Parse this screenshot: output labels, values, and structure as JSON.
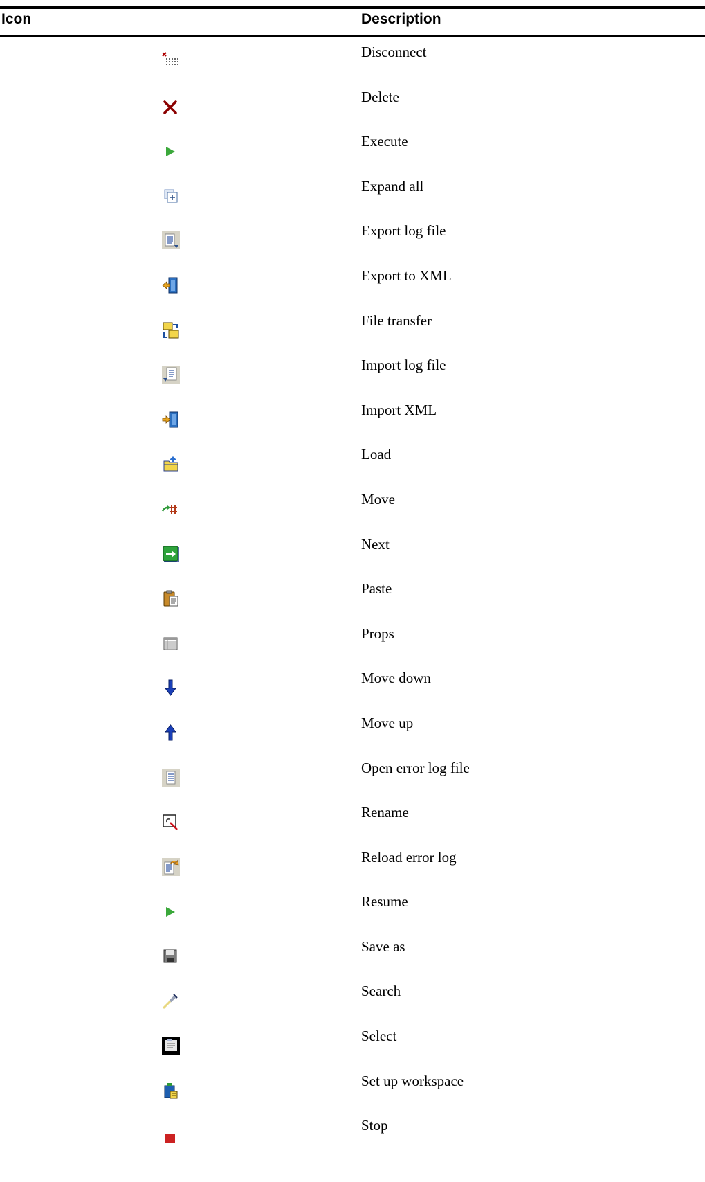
{
  "headers": {
    "icon": "Icon",
    "description": "Description"
  },
  "rows": [
    {
      "icon": "disconnect-icon",
      "label": "Disconnect"
    },
    {
      "icon": "delete-icon",
      "label": "Delete"
    },
    {
      "icon": "execute-icon",
      "label": "Execute"
    },
    {
      "icon": "expand-all-icon",
      "label": "Expand all"
    },
    {
      "icon": "export-log-file-icon",
      "label": "Export log file"
    },
    {
      "icon": "export-to-xml-icon",
      "label": "Export to XML"
    },
    {
      "icon": "file-transfer-icon",
      "label": "File transfer"
    },
    {
      "icon": "import-log-file-icon",
      "label": "Import log file"
    },
    {
      "icon": "import-xml-icon",
      "label": "Import XML"
    },
    {
      "icon": "load-icon",
      "label": "Load"
    },
    {
      "icon": "move-icon",
      "label": "Move"
    },
    {
      "icon": "next-icon",
      "label": "Next"
    },
    {
      "icon": "paste-icon",
      "label": "Paste"
    },
    {
      "icon": "props-icon",
      "label": "Props"
    },
    {
      "icon": "move-down-icon",
      "label": "Move down"
    },
    {
      "icon": "move-up-icon",
      "label": "Move up"
    },
    {
      "icon": "open-error-log-file-icon",
      "label": "Open error log file"
    },
    {
      "icon": "rename-icon",
      "label": "Rename"
    },
    {
      "icon": "reload-error-log-icon",
      "label": "Reload error log"
    },
    {
      "icon": "resume-icon",
      "label": "Resume"
    },
    {
      "icon": "save-as-icon",
      "label": "Save as"
    },
    {
      "icon": "search-icon",
      "label": "Search"
    },
    {
      "icon": "select-icon",
      "label": "Select"
    },
    {
      "icon": "set-up-workspace-icon",
      "label": "Set up workspace"
    },
    {
      "icon": "stop-icon",
      "label": "Stop"
    }
  ]
}
